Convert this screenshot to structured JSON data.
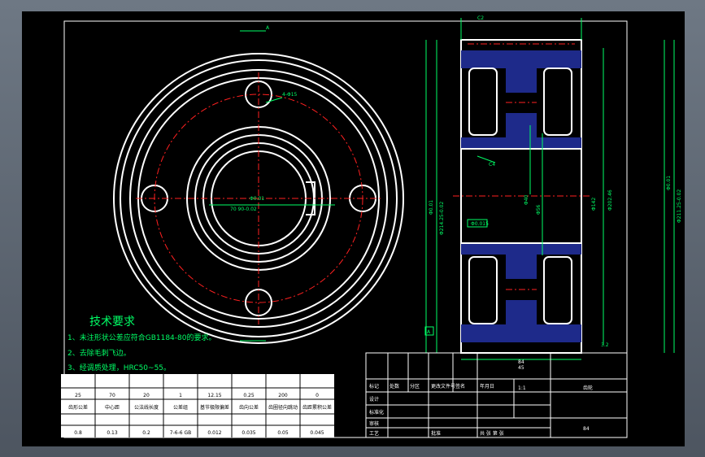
{
  "notes": {
    "title": "技术要求",
    "items": [
      "1、未注形状公差应符合GB1184-80的要求。",
      "2、去除毛刺飞边。",
      "3、经调质处理，HRC50~55。"
    ]
  },
  "front_view": {
    "hole_label": "4-Φ15",
    "bore_label": "Φ0.01",
    "keyway_label": "70 90-0.02",
    "section_mark": "A"
  },
  "section_view": {
    "top_label": "C2",
    "dims_left": [
      "Φ0.01",
      "Φ214.25-0.02"
    ],
    "dims_right": [
      "Φ0.01",
      "Φ211.25-0.02",
      "Φ142",
      "Φ202.46"
    ],
    "dims_inner": [
      "Φ40",
      "Φ56"
    ],
    "chamfer": "C4",
    "tol_box": "Φ0.015",
    "datum": "A",
    "roughness": "3.2",
    "bottom_label": "84"
  },
  "spec_table": {
    "rows": [
      [
        "",
        "",
        "",
        "",
        "",
        "",
        "",
        ""
      ],
      [
        "25",
        "70",
        "20",
        "1",
        "12.15",
        "0.25",
        "200",
        "0"
      ],
      [
        "齿形公差",
        "中心距",
        "公法线长度",
        "公差组",
        "基节极限偏差",
        "齿向公差",
        "齿圈径向跳动",
        "齿距累积公差"
      ],
      [
        "",
        "",
        "",
        "",
        "",
        "",
        "",
        ""
      ],
      [
        "0.8",
        "0.13",
        "0.2",
        "7-6-6 GB",
        "0.012",
        "0.035",
        "0.05",
        "0.045"
      ]
    ]
  },
  "title_block": {
    "scale_row": [
      "标记",
      "处数",
      "分区",
      "更改文件号",
      "签名",
      "年月日"
    ],
    "labels": [
      "设计",
      "标准化",
      "审核",
      "工艺",
      "批准"
    ],
    "material": "45",
    "qty": "1:1",
    "drawing_no": "齿轮",
    "company": "",
    "sheet": "共 张 第 张",
    "weight": "84"
  }
}
